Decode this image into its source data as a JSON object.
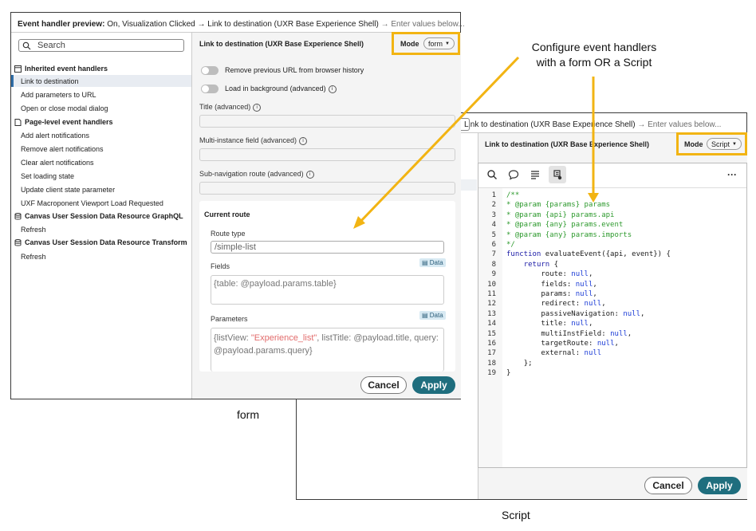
{
  "form_window": {
    "header": {
      "prefix": "Event handler preview:",
      "context": "On, Visualization Clicked",
      "arrow": "→",
      "target": "Link to destination (UXR Base Experience Shell)",
      "hint": "→ Enter values below..."
    },
    "search": {
      "placeholder": "Search"
    },
    "sidebar": {
      "groups": [
        {
          "label": "Inherited event handlers",
          "icon": "window-icon",
          "items": [
            "Link to destination",
            "Add parameters to URL",
            "Open or close modal dialog"
          ]
        },
        {
          "label": "Page-level event handlers",
          "icon": "document-icon",
          "items": [
            "Add alert notifications",
            "Remove alert notifications",
            "Clear alert notifications",
            "Set loading state",
            "Update client state parameter",
            "UXF Macroponent Viewport Load Requested"
          ]
        },
        {
          "label": "Canvas User Session Data Resource GraphQL",
          "icon": "database-icon",
          "items": [
            "Refresh"
          ]
        },
        {
          "label": "Canvas User Session Data Resource Transform",
          "icon": "database-icon",
          "items": [
            "Refresh"
          ]
        }
      ],
      "selected": "Link to destination"
    },
    "panel": {
      "title": "Link to destination (UXR Base Experience Shell)",
      "mode_label": "Mode",
      "mode_value": "form",
      "toggles": [
        "Remove previous URL from browser history",
        "Load in background (advanced)"
      ],
      "fields": [
        "Title (advanced)",
        "Multi-instance field (advanced)",
        "Sub-navigation route (advanced)"
      ],
      "current_route": {
        "heading": "Current route",
        "route_type_label": "Route type",
        "route_type_value": "/simple-list",
        "fields_label": "Fields",
        "fields_badge": "Data",
        "fields_value": "{table: @payload.params.table}",
        "parameters_label": "Parameters",
        "parameters_badge": "Data",
        "parameters_value_a": "{listView: ",
        "parameters_value_str": "\"Experience_list\"",
        "parameters_value_b": ", listTitle: @payload.title, query:",
        "parameters_value_c": "@payload.params.query}"
      },
      "cancel_label": "Cancel",
      "apply_label": "Apply"
    }
  },
  "script_window": {
    "header": {
      "target": "Link to destination (UXR Base Experience Shell)",
      "hint": "→ Enter values below..."
    },
    "panel": {
      "title": "Link to destination (UXR Base Experience Shell)",
      "mode_label": "Mode",
      "mode_value": "Script",
      "toolbar": [
        "search-icon",
        "comment-icon",
        "format-icon",
        "script-icon",
        "more-icon"
      ],
      "code_lines": [
        {
          "n": "1",
          "t": "/**",
          "c": "com"
        },
        {
          "n": "2",
          "t": "* @param {params} params",
          "c": "com"
        },
        {
          "n": "3",
          "t": "* @param {api} params.api",
          "c": "com"
        },
        {
          "n": "4",
          "t": "* @param {any} params.event",
          "c": "com"
        },
        {
          "n": "5",
          "t": "* @param {any} params.imports",
          "c": "com"
        },
        {
          "n": "6",
          "t": "*/",
          "c": "com"
        },
        {
          "n": "7",
          "kw": "function",
          "t": " evaluateEvent({api, event}) {"
        },
        {
          "n": "8",
          "ind": "    ",
          "kw": "return",
          "t": " {"
        },
        {
          "n": "9",
          "ind": "        ",
          "t": "route: ",
          "nul": "null",
          "e": ","
        },
        {
          "n": "10",
          "ind": "        ",
          "t": "fields: ",
          "nul": "null",
          "e": ","
        },
        {
          "n": "11",
          "ind": "        ",
          "t": "params: ",
          "nul": "null",
          "e": ","
        },
        {
          "n": "12",
          "ind": "        ",
          "t": "redirect: ",
          "nul": "null",
          "e": ","
        },
        {
          "n": "13",
          "ind": "        ",
          "t": "passiveNavigation: ",
          "nul": "null",
          "e": ","
        },
        {
          "n": "14",
          "ind": "        ",
          "t": "title: ",
          "nul": "null",
          "e": ","
        },
        {
          "n": "15",
          "ind": "        ",
          "t": "multiInstField: ",
          "nul": "null",
          "e": ","
        },
        {
          "n": "16",
          "ind": "        ",
          "t": "targetRoute: ",
          "nul": "null",
          "e": ","
        },
        {
          "n": "17",
          "ind": "        ",
          "t": "external: ",
          "nul": "null",
          "e": ""
        },
        {
          "n": "18",
          "ind": "    ",
          "t": "};"
        },
        {
          "n": "19",
          "t": "}"
        }
      ],
      "cancel_label": "Cancel",
      "apply_label": "Apply"
    }
  },
  "annotations": {
    "callout_line1": "Configure event handlers",
    "callout_line2": "with a form OR a Script",
    "caption_form": "form",
    "caption_script": "Script",
    "highlight_color": "#f2b413"
  }
}
